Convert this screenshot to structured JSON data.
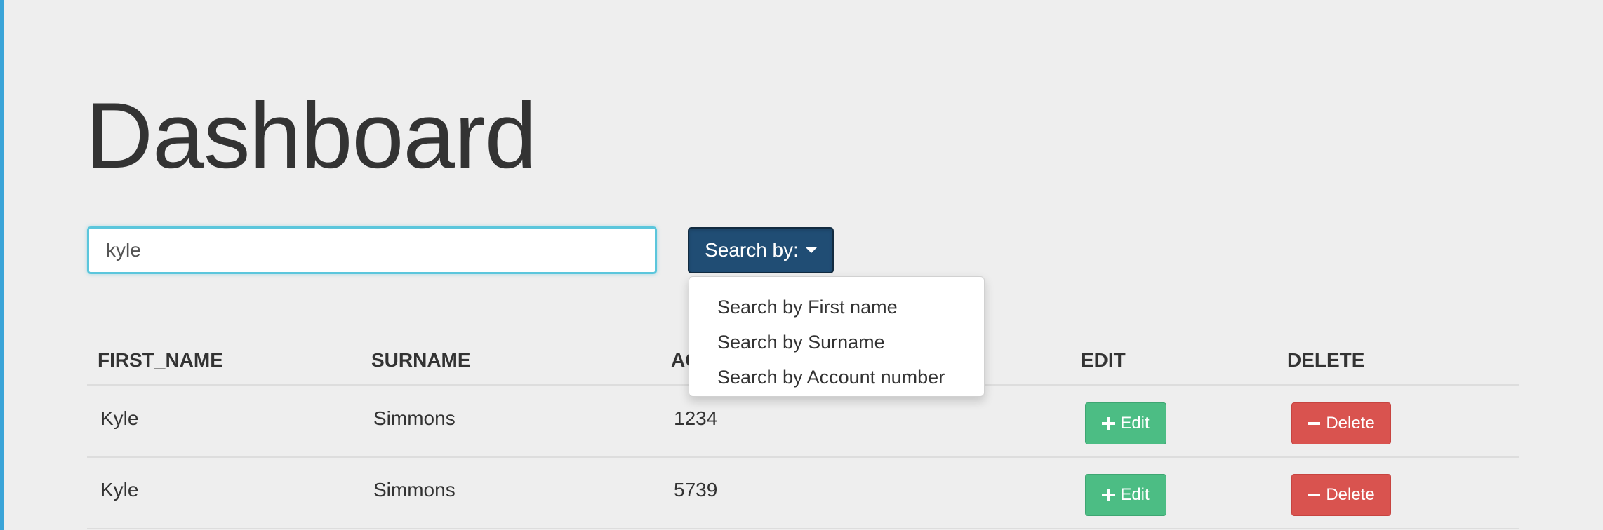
{
  "page": {
    "title": "Dashboard"
  },
  "search": {
    "value": "kyle",
    "button_label": "Search by:",
    "dropdown_options": [
      "Search by First name",
      "Search by Surname",
      "Search by Account number"
    ]
  },
  "table": {
    "columns": [
      "FIRST_NAME",
      "SURNAME",
      "AC",
      "EDIT",
      "DELETE"
    ],
    "rows": [
      {
        "first_name": "Kyle",
        "surname": "Simmons",
        "account": "1234",
        "edit_label": "Edit",
        "delete_label": "Delete"
      },
      {
        "first_name": "Kyle",
        "surname": "Simmons",
        "account": "5739",
        "edit_label": "Edit",
        "delete_label": "Delete"
      }
    ]
  },
  "colors": {
    "accent_border": "#5bc6dc",
    "search_button": "#204d74",
    "edit_button": "#4cbd84",
    "delete_button": "#d9534f",
    "background": "#eeeeee"
  },
  "icons": {
    "button_caret": "caret-down-icon",
    "edit": "plus-icon",
    "delete": "minus-icon"
  }
}
